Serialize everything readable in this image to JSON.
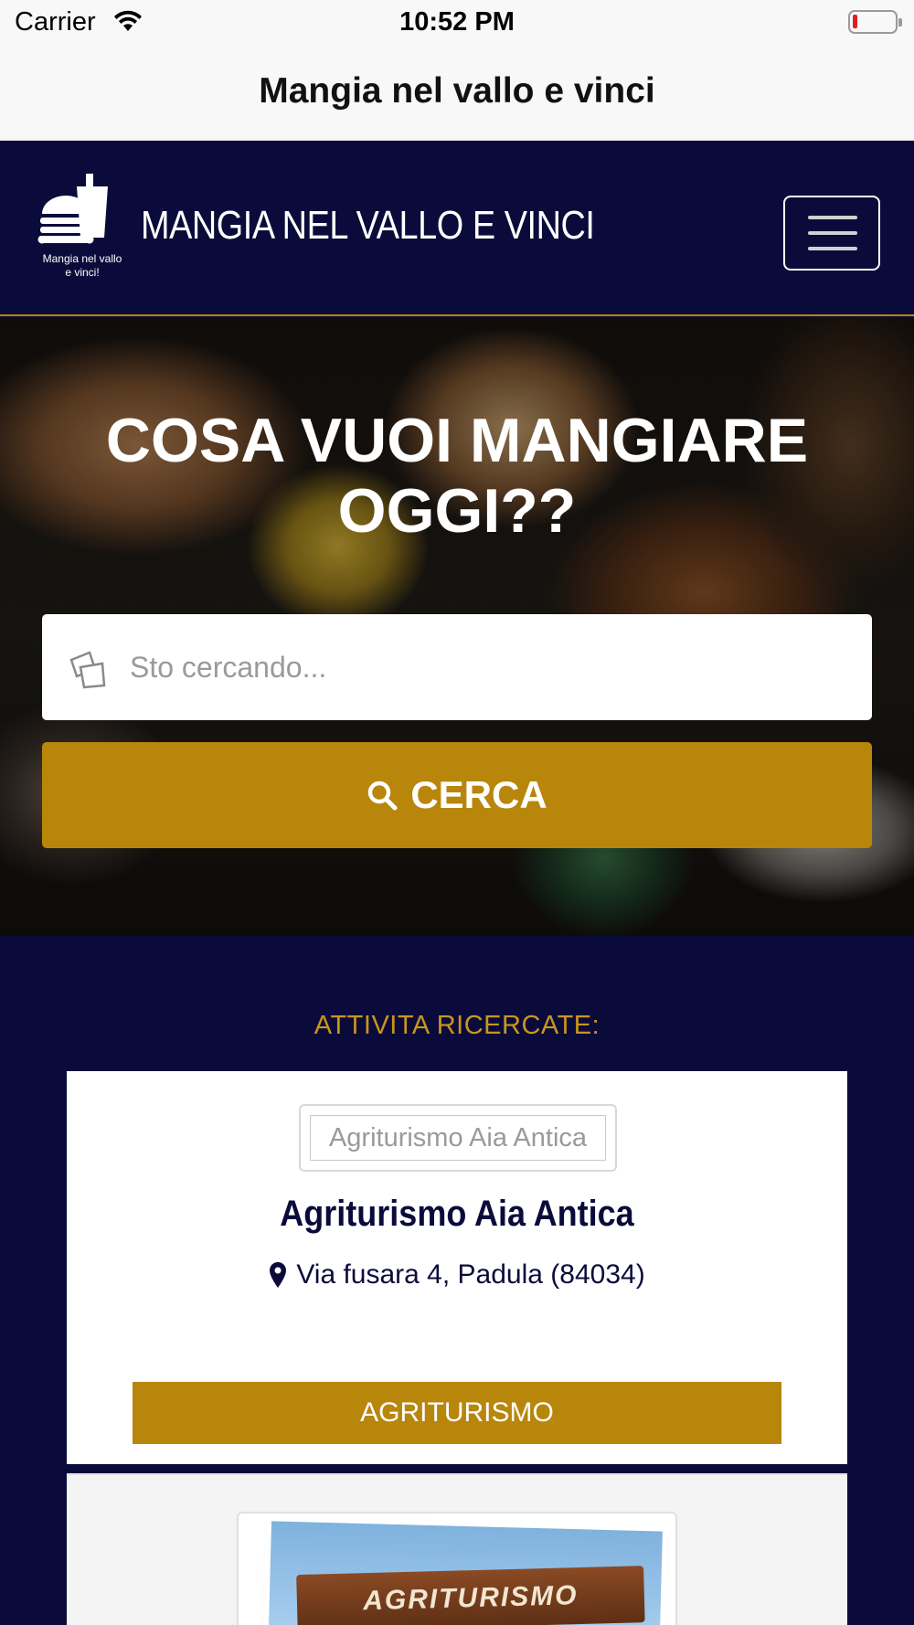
{
  "status_bar": {
    "carrier": "Carrier",
    "time": "10:52 PM",
    "wifi_icon": "wifi-icon",
    "battery_icon": "battery-low-icon"
  },
  "nav": {
    "title": "Mangia nel vallo e vinci"
  },
  "header": {
    "logo_caption_line1": "Mangia nel vallo",
    "logo_caption_line2": "e vinci!",
    "site_title": "MANGIA NEL VALLO E VINCI",
    "menu_icon": "hamburger-menu-icon"
  },
  "hero": {
    "title_line1": "COSA VUOI MANGIARE",
    "title_line2": "OGGI??",
    "search_placeholder": "Sto cercando...",
    "search_button_label": "CERCA"
  },
  "results": {
    "heading": "ATTIVITA RICERCATE:",
    "items": [
      {
        "logo_alt": "Agriturismo Aia Antica",
        "name": "Agriturismo Aia Antica",
        "address": "Via fusara 4, Padula (84034)",
        "category": "AGRITURISMO"
      },
      {
        "sign_text": "AGRITURISMO"
      }
    ]
  },
  "colors": {
    "navy": "#0b0b3b",
    "gold": "#b8860b",
    "heading_gold": "#c9961a"
  }
}
